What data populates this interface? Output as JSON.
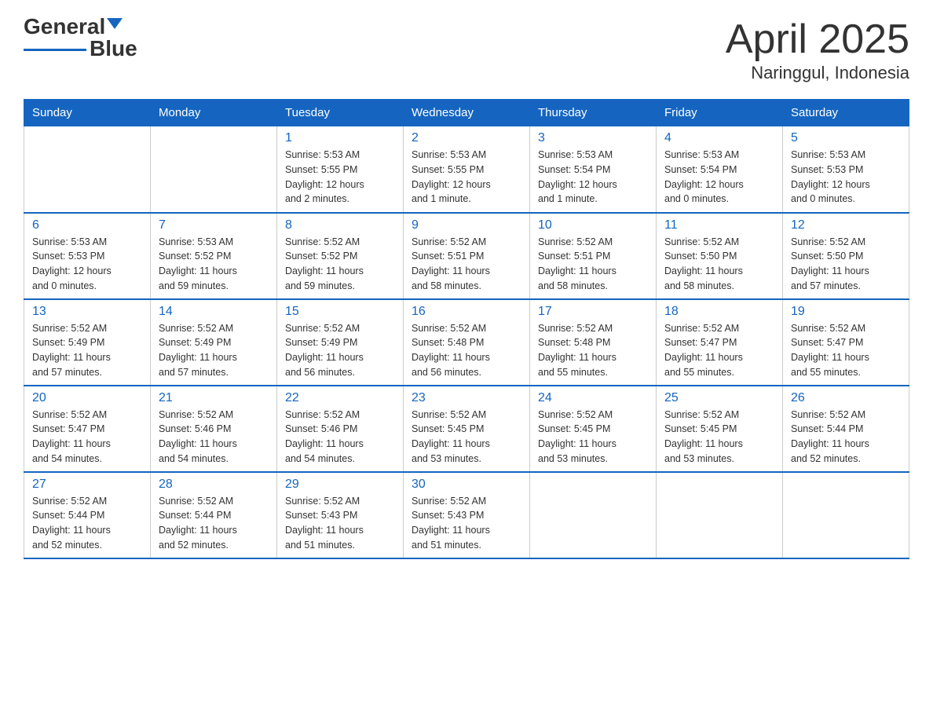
{
  "logo": {
    "text_general": "General",
    "text_blue": "Blue"
  },
  "title": {
    "month_year": "April 2025",
    "location": "Naringgul, Indonesia"
  },
  "days_of_week": [
    "Sunday",
    "Monday",
    "Tuesday",
    "Wednesday",
    "Thursday",
    "Friday",
    "Saturday"
  ],
  "weeks": [
    [
      {
        "day": "",
        "info": ""
      },
      {
        "day": "",
        "info": ""
      },
      {
        "day": "1",
        "info": "Sunrise: 5:53 AM\nSunset: 5:55 PM\nDaylight: 12 hours\nand 2 minutes."
      },
      {
        "day": "2",
        "info": "Sunrise: 5:53 AM\nSunset: 5:55 PM\nDaylight: 12 hours\nand 1 minute."
      },
      {
        "day": "3",
        "info": "Sunrise: 5:53 AM\nSunset: 5:54 PM\nDaylight: 12 hours\nand 1 minute."
      },
      {
        "day": "4",
        "info": "Sunrise: 5:53 AM\nSunset: 5:54 PM\nDaylight: 12 hours\nand 0 minutes."
      },
      {
        "day": "5",
        "info": "Sunrise: 5:53 AM\nSunset: 5:53 PM\nDaylight: 12 hours\nand 0 minutes."
      }
    ],
    [
      {
        "day": "6",
        "info": "Sunrise: 5:53 AM\nSunset: 5:53 PM\nDaylight: 12 hours\nand 0 minutes."
      },
      {
        "day": "7",
        "info": "Sunrise: 5:53 AM\nSunset: 5:52 PM\nDaylight: 11 hours\nand 59 minutes."
      },
      {
        "day": "8",
        "info": "Sunrise: 5:52 AM\nSunset: 5:52 PM\nDaylight: 11 hours\nand 59 minutes."
      },
      {
        "day": "9",
        "info": "Sunrise: 5:52 AM\nSunset: 5:51 PM\nDaylight: 11 hours\nand 58 minutes."
      },
      {
        "day": "10",
        "info": "Sunrise: 5:52 AM\nSunset: 5:51 PM\nDaylight: 11 hours\nand 58 minutes."
      },
      {
        "day": "11",
        "info": "Sunrise: 5:52 AM\nSunset: 5:50 PM\nDaylight: 11 hours\nand 58 minutes."
      },
      {
        "day": "12",
        "info": "Sunrise: 5:52 AM\nSunset: 5:50 PM\nDaylight: 11 hours\nand 57 minutes."
      }
    ],
    [
      {
        "day": "13",
        "info": "Sunrise: 5:52 AM\nSunset: 5:49 PM\nDaylight: 11 hours\nand 57 minutes."
      },
      {
        "day": "14",
        "info": "Sunrise: 5:52 AM\nSunset: 5:49 PM\nDaylight: 11 hours\nand 57 minutes."
      },
      {
        "day": "15",
        "info": "Sunrise: 5:52 AM\nSunset: 5:49 PM\nDaylight: 11 hours\nand 56 minutes."
      },
      {
        "day": "16",
        "info": "Sunrise: 5:52 AM\nSunset: 5:48 PM\nDaylight: 11 hours\nand 56 minutes."
      },
      {
        "day": "17",
        "info": "Sunrise: 5:52 AM\nSunset: 5:48 PM\nDaylight: 11 hours\nand 55 minutes."
      },
      {
        "day": "18",
        "info": "Sunrise: 5:52 AM\nSunset: 5:47 PM\nDaylight: 11 hours\nand 55 minutes."
      },
      {
        "day": "19",
        "info": "Sunrise: 5:52 AM\nSunset: 5:47 PM\nDaylight: 11 hours\nand 55 minutes."
      }
    ],
    [
      {
        "day": "20",
        "info": "Sunrise: 5:52 AM\nSunset: 5:47 PM\nDaylight: 11 hours\nand 54 minutes."
      },
      {
        "day": "21",
        "info": "Sunrise: 5:52 AM\nSunset: 5:46 PM\nDaylight: 11 hours\nand 54 minutes."
      },
      {
        "day": "22",
        "info": "Sunrise: 5:52 AM\nSunset: 5:46 PM\nDaylight: 11 hours\nand 54 minutes."
      },
      {
        "day": "23",
        "info": "Sunrise: 5:52 AM\nSunset: 5:45 PM\nDaylight: 11 hours\nand 53 minutes."
      },
      {
        "day": "24",
        "info": "Sunrise: 5:52 AM\nSunset: 5:45 PM\nDaylight: 11 hours\nand 53 minutes."
      },
      {
        "day": "25",
        "info": "Sunrise: 5:52 AM\nSunset: 5:45 PM\nDaylight: 11 hours\nand 53 minutes."
      },
      {
        "day": "26",
        "info": "Sunrise: 5:52 AM\nSunset: 5:44 PM\nDaylight: 11 hours\nand 52 minutes."
      }
    ],
    [
      {
        "day": "27",
        "info": "Sunrise: 5:52 AM\nSunset: 5:44 PM\nDaylight: 11 hours\nand 52 minutes."
      },
      {
        "day": "28",
        "info": "Sunrise: 5:52 AM\nSunset: 5:44 PM\nDaylight: 11 hours\nand 52 minutes."
      },
      {
        "day": "29",
        "info": "Sunrise: 5:52 AM\nSunset: 5:43 PM\nDaylight: 11 hours\nand 51 minutes."
      },
      {
        "day": "30",
        "info": "Sunrise: 5:52 AM\nSunset: 5:43 PM\nDaylight: 11 hours\nand 51 minutes."
      },
      {
        "day": "",
        "info": ""
      },
      {
        "day": "",
        "info": ""
      },
      {
        "day": "",
        "info": ""
      }
    ]
  ]
}
